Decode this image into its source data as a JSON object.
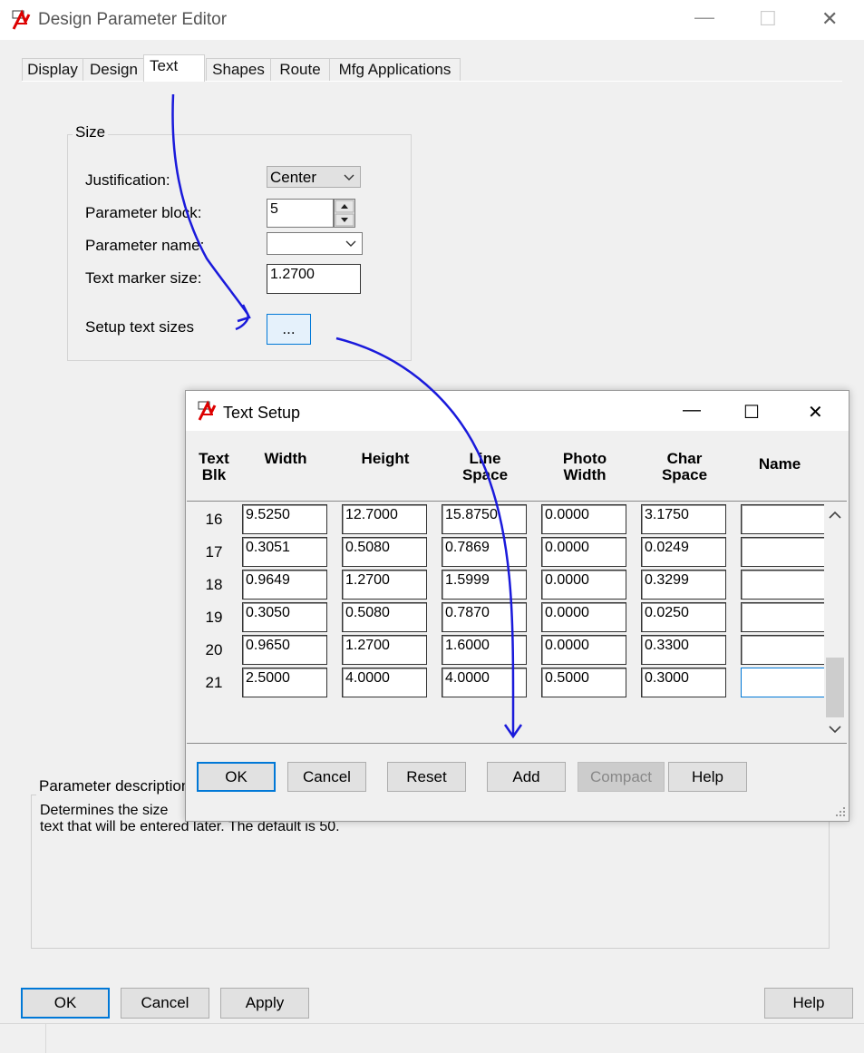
{
  "window": {
    "title": "Design Parameter Editor",
    "min_glyph": "—",
    "max_glyph": "☐",
    "close_glyph": "✕"
  },
  "tabs": [
    {
      "label": "Display"
    },
    {
      "label": "Design"
    },
    {
      "label": "Text"
    },
    {
      "label": "Shapes"
    },
    {
      "label": "Route"
    },
    {
      "label": "Mfg Applications"
    }
  ],
  "size_group": {
    "title": "Size",
    "justification_label": "Justification:",
    "justification_value": "Center",
    "param_block_label": "Parameter block:",
    "param_block_value": "5",
    "param_name_label": "Parameter name:",
    "param_name_value": "",
    "marker_size_label": "Text marker size:",
    "marker_size_value": "1.2700",
    "setup_label": "Setup text sizes",
    "setup_button": "..."
  },
  "description": {
    "title": "Parameter description",
    "line1": "Determines the size",
    "line2": "text that will be entered later. The default is 50."
  },
  "bottom_buttons": {
    "ok": "OK",
    "cancel": "Cancel",
    "apply": "Apply",
    "help": "Help"
  },
  "text_setup": {
    "title": "Text Setup",
    "headers": {
      "blk1": "Text",
      "blk2": "Blk",
      "width": "Width",
      "height": "Height",
      "line1": "Line",
      "line2": "Space",
      "photo1": "Photo",
      "photo2": "Width",
      "char1": "Char",
      "char2": "Space",
      "name": "Name"
    },
    "rows": [
      {
        "blk": "16",
        "width": "9.5250",
        "height": "12.7000",
        "line": "15.8750",
        "photo": "0.0000",
        "char": "3.1750",
        "name": ""
      },
      {
        "blk": "17",
        "width": "0.3051",
        "height": "0.5080",
        "line": "0.7869",
        "photo": "0.0000",
        "char": "0.0249",
        "name": ""
      },
      {
        "blk": "18",
        "width": "0.9649",
        "height": "1.2700",
        "line": "1.5999",
        "photo": "0.0000",
        "char": "0.3299",
        "name": ""
      },
      {
        "blk": "19",
        "width": "0.3050",
        "height": "0.5080",
        "line": "0.7870",
        "photo": "0.0000",
        "char": "0.0250",
        "name": ""
      },
      {
        "blk": "20",
        "width": "0.9650",
        "height": "1.2700",
        "line": "1.6000",
        "photo": "0.0000",
        "char": "0.3300",
        "name": ""
      },
      {
        "blk": "21",
        "width": "2.5000",
        "height": "4.0000",
        "line": "4.0000",
        "photo": "0.5000",
        "char": "0.3000",
        "name": ""
      }
    ],
    "buttons": {
      "ok": "OK",
      "cancel": "Cancel",
      "reset": "Reset",
      "add": "Add",
      "compact": "Compact",
      "help": "Help"
    }
  },
  "colors": {
    "annotation_arrow": "#1a1adb",
    "focus_blue": "#0078d7"
  }
}
